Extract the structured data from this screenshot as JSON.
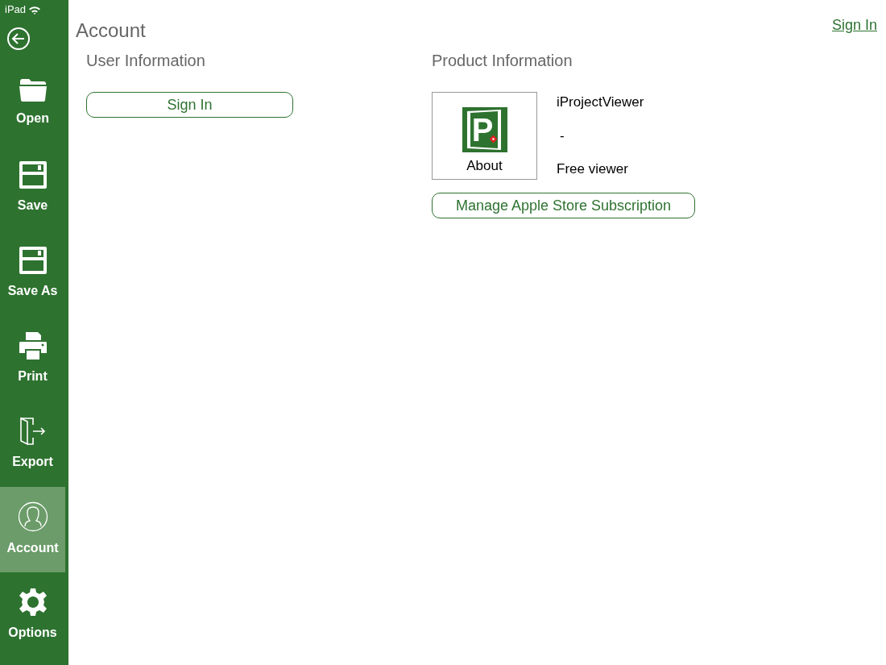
{
  "status_bar": {
    "device": "iPad"
  },
  "sidebar": {
    "items": [
      {
        "kind": "open",
        "label": "Open",
        "selected": false
      },
      {
        "kind": "save",
        "label": "Save",
        "selected": false
      },
      {
        "kind": "save",
        "label": "Save As",
        "selected": false
      },
      {
        "kind": "print",
        "label": "Print",
        "selected": false
      },
      {
        "kind": "export",
        "label": "Export",
        "selected": false
      },
      {
        "kind": "account",
        "label": "Account",
        "selected": true
      },
      {
        "kind": "options",
        "label": "Options",
        "selected": false
      }
    ]
  },
  "page": {
    "title": "Account",
    "top_link": "Sign In"
  },
  "user_information": {
    "heading": "User Information",
    "button": "Sign In"
  },
  "product_information": {
    "heading": "Product Information",
    "logo_letter": "P",
    "about": "About",
    "name": "iProjectViewer",
    "version": "-",
    "edition": "Free viewer",
    "button": "Manage Apple Store Subscription"
  }
}
